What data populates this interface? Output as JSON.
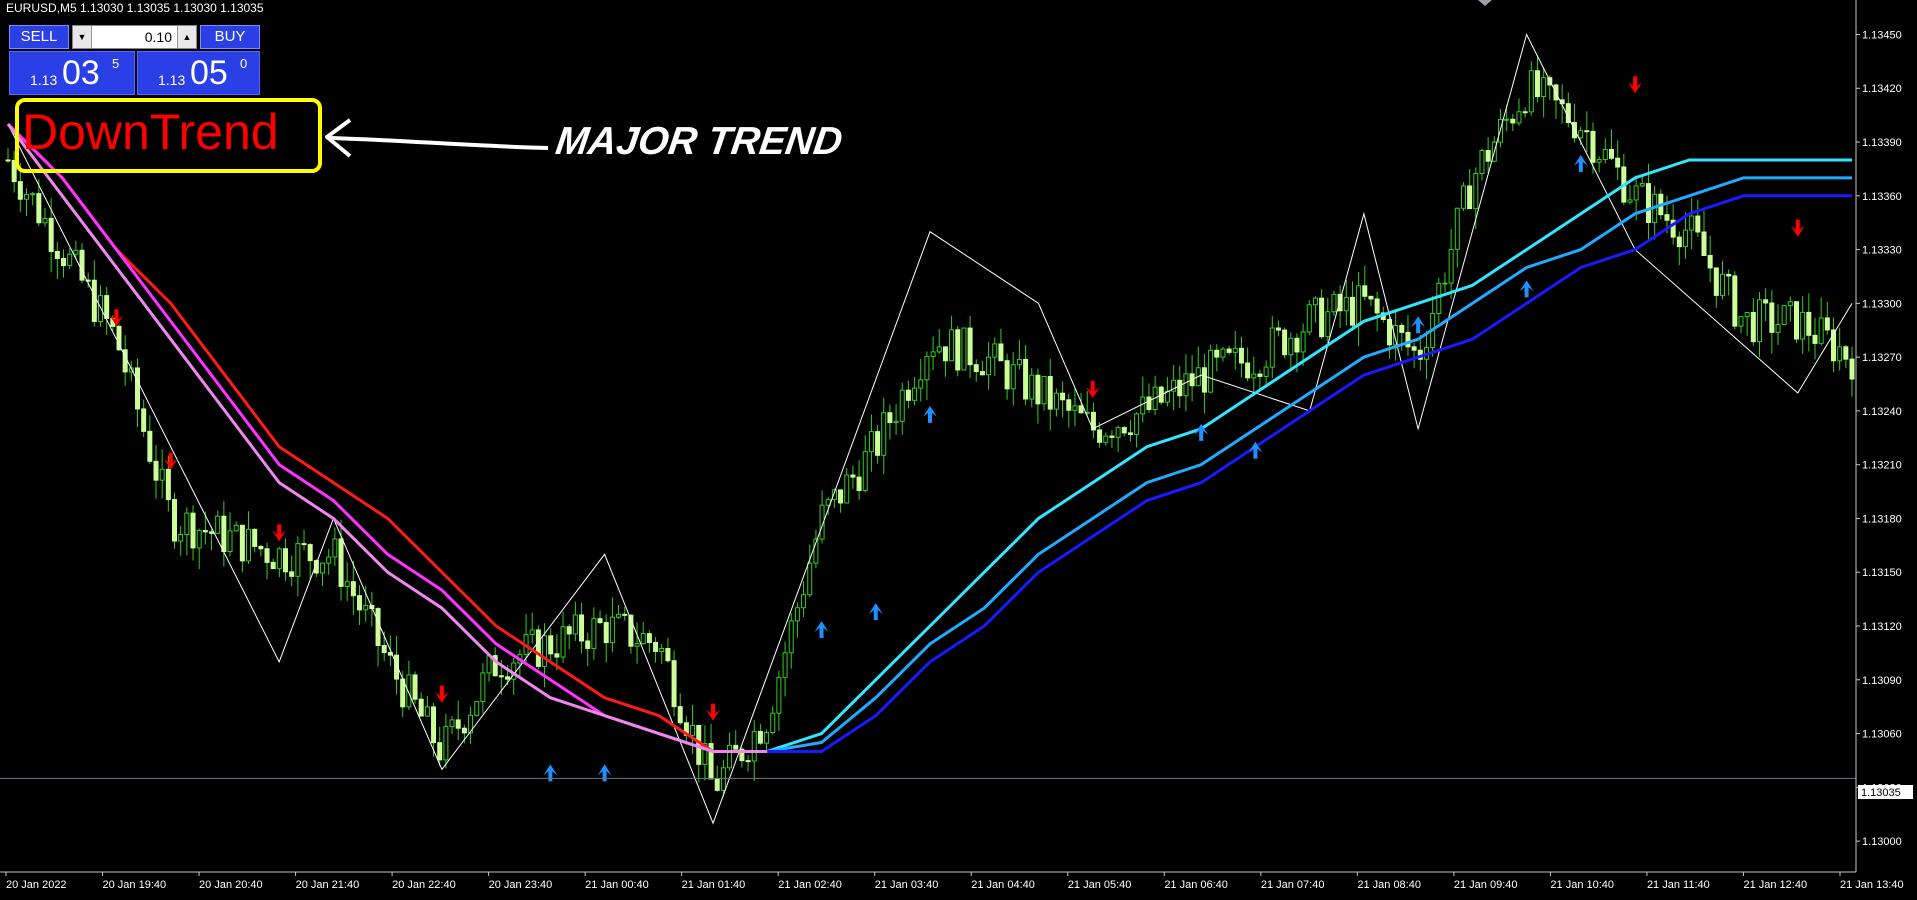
{
  "window": {
    "symbol_info": "EURUSD,M5  1.13030 1.13035 1.13030 1.13035"
  },
  "trade_panel": {
    "sell_label": "SELL",
    "buy_label": "BUY",
    "lot_value": "0.10",
    "sell_quote": {
      "small": "1.13",
      "big": "03",
      "sup": "5"
    },
    "buy_quote": {
      "small": "1.13",
      "big": "05",
      "sup": "0"
    },
    "button_color": "#2b3fe6"
  },
  "annotations": {
    "trend_text": "DownTrend",
    "major_text": "MAJOR TREND",
    "trend_box_color": "#ffff00",
    "trend_text_color": "#ff0000"
  },
  "price_axis": {
    "labels": [
      "1.13450",
      "1.13420",
      "1.13390",
      "1.13360",
      "1.13330",
      "1.13300",
      "1.13270",
      "1.13240",
      "1.13210",
      "1.13180",
      "1.13150",
      "1.13120",
      "1.13090",
      "1.13060",
      "1.13030",
      "1.13000"
    ],
    "current_price": "1.13035"
  },
  "time_axis": {
    "labels": [
      "20 Jan 2022",
      "20 Jan 19:40",
      "20 Jan 20:40",
      "20 Jan 21:40",
      "20 Jan 22:40",
      "20 Jan 23:40",
      "21 Jan 00:40",
      "21 Jan 01:40",
      "21 Jan 02:40",
      "21 Jan 03:40",
      "21 Jan 04:40",
      "21 Jan 05:40",
      "21 Jan 06:40",
      "21 Jan 07:40",
      "21 Jan 08:40",
      "21 Jan 09:40",
      "21 Jan 10:40",
      "21 Jan 11:40",
      "21 Jan 12:40",
      "21 Jan 13:40"
    ]
  },
  "chart_data": {
    "type": "line",
    "ylim": [
      1.12985,
      1.13467
    ],
    "x": [
      "20 Jan 18:40",
      "20 Jan 19:00",
      "20 Jan 19:40",
      "20 Jan 20:10",
      "20 Jan 20:40",
      "20 Jan 21:40",
      "20 Jan 21:55",
      "20 Jan 22:10",
      "20 Jan 22:40",
      "20 Jan 23:40",
      "21 Jan 00:40",
      "21 Jan 01:40",
      "21 Jan 02:00",
      "21 Jan 02:40",
      "21 Jan 03:00",
      "21 Jan 03:40",
      "21 Jan 04:10",
      "21 Jan 04:40",
      "21 Jan 05:10",
      "21 Jan 05:40",
      "21 Jan 06:40",
      "21 Jan 07:10",
      "21 Jan 07:40",
      "21 Jan 08:10",
      "21 Jan 08:40",
      "21 Jan 09:10",
      "21 Jan 09:40",
      "21 Jan 10:10",
      "21 Jan 10:40",
      "21 Jan 11:10",
      "21 Jan 11:40",
      "21 Jan 12:10",
      "21 Jan 12:40",
      "21 Jan 13:10",
      "21 Jan 13:40"
    ],
    "series": [
      {
        "color": "#44dd22",
        "values": [
          1.1338,
          1.1333,
          1.1328,
          1.1318,
          1.1317,
          1.1316,
          1.1316,
          1.131,
          1.1305,
          1.131,
          1.1311,
          1.1312,
          1.1311,
          1.1303,
          1.1307,
          1.1318,
          1.1322,
          1.1328,
          1.1327,
          1.1325,
          1.1323,
          1.1324,
          1.1326,
          1.1327,
          1.1329,
          1.133,
          1.1327,
          1.1337,
          1.1342,
          1.134,
          1.1336,
          1.1334,
          1.1329,
          1.1329,
          1.1327
        ]
      },
      {
        "color": "#ffffff",
        "values": [
          1.134,
          null,
          null,
          null,
          null,
          1.131,
          1.1318,
          null,
          1.1304,
          null,
          null,
          1.1316,
          null,
          1.1301,
          null,
          null,
          null,
          1.1334,
          null,
          1.133,
          1.1323,
          null,
          1.1326,
          null,
          1.1324,
          1.1335,
          1.1323,
          null,
          1.1345,
          null,
          1.1333,
          null,
          null,
          1.1325,
          1.133
        ]
      },
      {
        "color": "#ff1a1a",
        "values": [
          1.134,
          1.1337,
          1.1333,
          1.133,
          1.1326,
          1.1322,
          1.132,
          1.1318,
          1.1315,
          1.1312,
          1.131,
          1.1308,
          1.1307,
          1.1305,
          1.1305,
          null,
          null,
          null,
          null,
          null,
          null,
          null,
          null,
          null,
          null,
          null,
          null,
          null,
          null,
          null,
          null,
          null,
          null,
          null,
          null
        ]
      },
      {
        "color": "#ff33ff",
        "values": [
          1.134,
          1.1337,
          1.1333,
          1.1329,
          1.1325,
          1.1321,
          1.1319,
          1.1316,
          1.1314,
          1.1311,
          1.1309,
          1.1307,
          1.1306,
          1.1305,
          1.1305,
          null,
          null,
          null,
          null,
          null,
          null,
          null,
          null,
          null,
          null,
          null,
          null,
          null,
          null,
          null,
          null,
          null,
          null,
          null,
          null
        ]
      },
      {
        "color": "#ee88ee",
        "values": [
          1.134,
          1.1336,
          1.1332,
          1.1328,
          1.1324,
          1.132,
          1.1318,
          1.1315,
          1.1313,
          1.131,
          1.1308,
          1.1307,
          1.1306,
          1.1305,
          1.1305,
          null,
          null,
          null,
          null,
          null,
          null,
          null,
          null,
          null,
          null,
          null,
          null,
          null,
          null,
          null,
          null,
          null,
          null,
          null,
          null
        ]
      },
      {
        "color": "#33e5ff",
        "values": [
          null,
          null,
          null,
          null,
          null,
          null,
          null,
          null,
          null,
          null,
          null,
          null,
          null,
          null,
          1.1305,
          1.1306,
          1.1309,
          1.1312,
          1.1315,
          1.1318,
          1.132,
          1.1322,
          1.1323,
          1.1325,
          1.1327,
          1.1329,
          1.133,
          1.1331,
          1.1333,
          1.1335,
          1.1337,
          1.1338,
          1.1338,
          1.1338,
          1.1338
        ]
      },
      {
        "color": "#22aaff",
        "values": [
          null,
          null,
          null,
          null,
          null,
          null,
          null,
          null,
          null,
          null,
          null,
          null,
          null,
          null,
          1.1305,
          1.13055,
          1.1308,
          1.1311,
          1.1313,
          1.1316,
          1.1318,
          1.132,
          1.1321,
          1.1323,
          1.1325,
          1.1327,
          1.1328,
          1.133,
          1.1332,
          1.1333,
          1.1335,
          1.1336,
          1.1337,
          1.1337,
          1.1337
        ]
      },
      {
        "color": "#1a1aff",
        "values": [
          null,
          null,
          null,
          null,
          null,
          null,
          null,
          null,
          null,
          null,
          null,
          null,
          null,
          null,
          1.1305,
          1.1305,
          1.1307,
          1.131,
          1.1312,
          1.1315,
          1.1317,
          1.1319,
          1.132,
          1.1322,
          1.1324,
          1.1326,
          1.1327,
          1.1328,
          1.133,
          1.1332,
          1.1333,
          1.1335,
          1.1336,
          1.1336,
          1.1336
        ]
      }
    ],
    "signals": [
      {
        "x": "20 Jan 19:40",
        "y": 1.1329,
        "dir": "down"
      },
      {
        "x": "20 Jan 20:10",
        "y": 1.1321,
        "dir": "down"
      },
      {
        "x": "20 Jan 21:40",
        "y": 1.1317,
        "dir": "down"
      },
      {
        "x": "20 Jan 22:40",
        "y": 1.1308,
        "dir": "down"
      },
      {
        "x": "21 Jan 00:40",
        "y": 1.1304,
        "dir": "up"
      },
      {
        "x": "21 Jan 01:40",
        "y": 1.1304,
        "dir": "up"
      },
      {
        "x": "21 Jan 02:40",
        "y": 1.1307,
        "dir": "down"
      },
      {
        "x": "21 Jan 03:40",
        "y": 1.1312,
        "dir": "up"
      },
      {
        "x": "21 Jan 04:10",
        "y": 1.1313,
        "dir": "up"
      },
      {
        "x": "21 Jan 04:40",
        "y": 1.1324,
        "dir": "up"
      },
      {
        "x": "21 Jan 06:40",
        "y": 1.1325,
        "dir": "down"
      },
      {
        "x": "21 Jan 07:40",
        "y": 1.1323,
        "dir": "up"
      },
      {
        "x": "21 Jan 08:10",
        "y": 1.1322,
        "dir": "up"
      },
      {
        "x": "21 Jan 09:40",
        "y": 1.1329,
        "dir": "up"
      },
      {
        "x": "21 Jan 10:40",
        "y": 1.1331,
        "dir": "up"
      },
      {
        "x": "21 Jan 11:10",
        "y": 1.1338,
        "dir": "up"
      },
      {
        "x": "21 Jan 11:40",
        "y": 1.1342,
        "dir": "down"
      },
      {
        "x": "21 Jan 13:10",
        "y": 1.1334,
        "dir": "down"
      }
    ],
    "current_price": 1.13035,
    "grid": false
  }
}
